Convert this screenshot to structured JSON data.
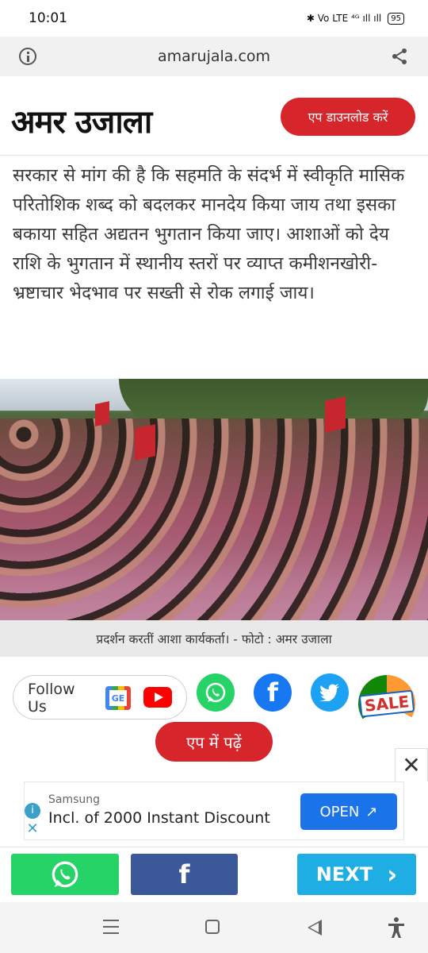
{
  "status_bar": {
    "time": "10:01",
    "indicators": "✱ Vo LTE ⁴ᴳ ıll ıll",
    "battery": "95"
  },
  "browser": {
    "url": "amarujala.com"
  },
  "header": {
    "logo": "अमर उजाला",
    "app_download_label": "एप डाउनलोड करें"
  },
  "article": {
    "paragraph": "सरकार से मांग की है कि सहमति के संदर्भ में स्वीकृति मासिक परितोशिक शब्द को बदलकर मानदेय किया जाय तथा इसका बकाया सहित अद्यतन भुगतान किया जाए। आशाओं को देय राशि के भुगतान में स्थानीय स्तरों पर व्याप्त कमीशनखोरी-भ्रष्टाचार भेदभाव पर सख्ती से रोक लगाई जाय।",
    "photo_caption": "प्रदर्शन करतीं आशा कार्यकर्ता। - फोटो : अमर उजाला"
  },
  "social": {
    "follow_label": "Follow Us",
    "gnews_text": "GE",
    "sale_label": "SALE",
    "read_in_app_label": "एप में पढ़ें"
  },
  "ad": {
    "brand": "Samsung",
    "text": "Incl. of 2000 Instant Discount",
    "cta": "OPEN",
    "cta_arrow": "↗",
    "close": "✕",
    "info": "i",
    "x": "✕"
  },
  "share_bar": {
    "facebook": "f",
    "next_label": "NEXT",
    "next_arrow": "›"
  },
  "colors": {
    "brand_red": "#d7262b",
    "whatsapp": "#25d366",
    "facebook": "#3b5998",
    "next": "#1faee3"
  }
}
